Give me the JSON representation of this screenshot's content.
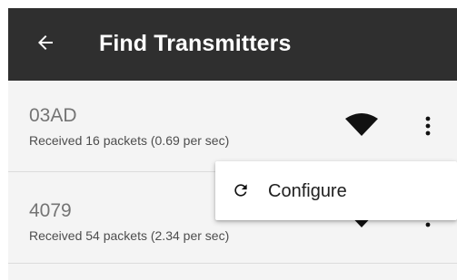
{
  "app_bar": {
    "title": "Find Transmitters",
    "back_icon": "arrow-left-icon"
  },
  "transmitters": [
    {
      "id": "03AD",
      "status": "Received 16 packets (0.69 per sec)",
      "signal_icon": "wifi-signal-icon",
      "more_icon": "more-vert-icon"
    },
    {
      "id": "4079",
      "status": "Received 54 packets (2.34 per sec)",
      "signal_icon": "wifi-signal-icon",
      "more_icon": "more-vert-icon"
    }
  ],
  "popup_menu": {
    "items": [
      {
        "label": "Configure",
        "icon": "refresh-icon"
      }
    ]
  },
  "colors": {
    "app_bar_background": "#2f2f2f",
    "list_background": "#f4f4f4",
    "popup_background": "#ffffff",
    "id_text": "#747474",
    "status_text": "#4d4d4d",
    "icon": "#111111"
  }
}
